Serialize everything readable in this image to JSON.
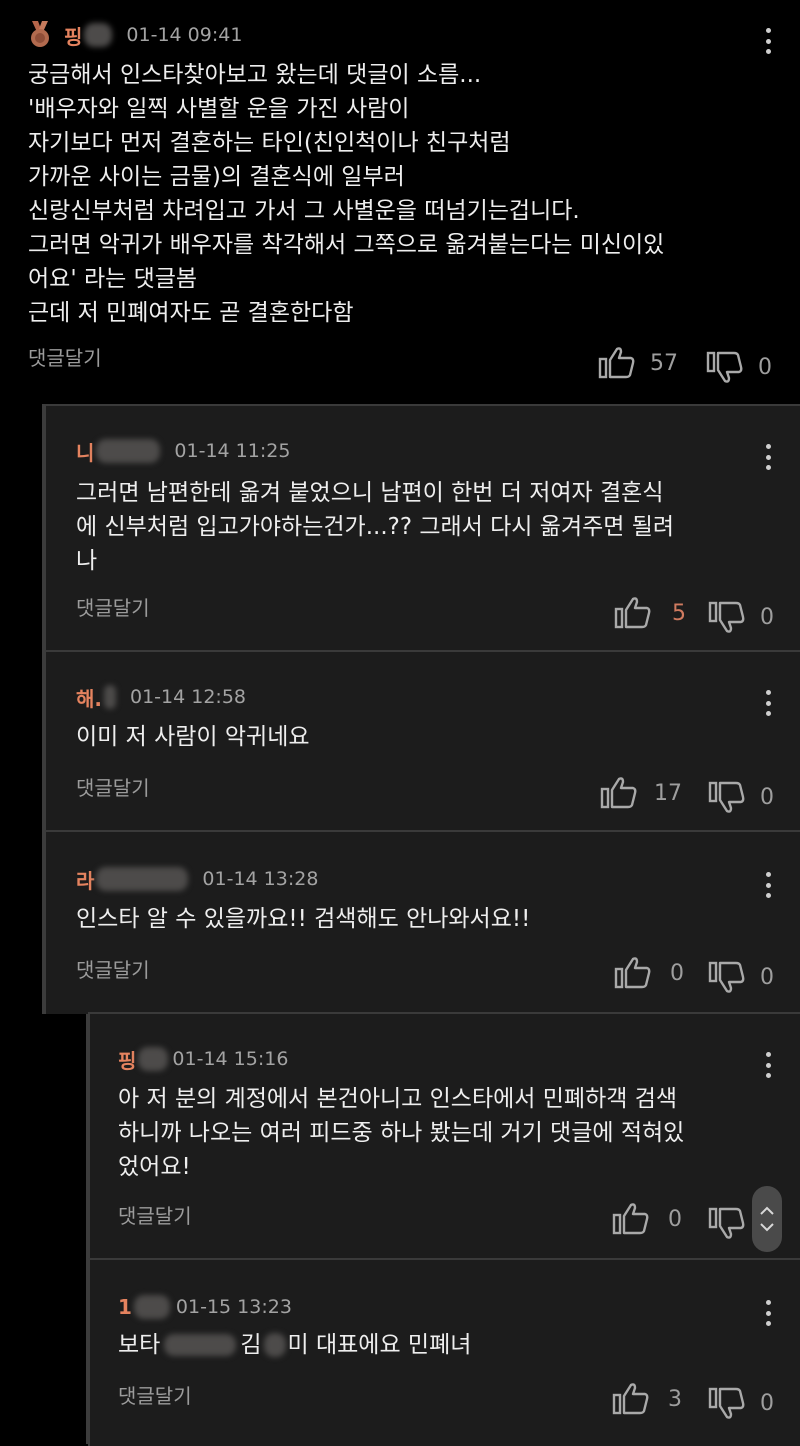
{
  "comments": [
    {
      "author_visible": "핑",
      "date": "01-14 09:41",
      "body": "궁금해서 인스타찾아보고 왔는데 댓글이 소름...\n'배우자와 일찍 사별할 운을 가진 사람이\n자기보다 먼저 결혼하는 타인(친인척이나 친구처럼\n가까운 사이는 금물)의 결혼식에 일부러\n신랑신부처럼 차려입고 가서 그 사별운을 떠넘기는겁니다.\n그러면 악귀가 배우자를 착각해서 그쪽으로 옮겨붙는다는 미신이있\n어요' 라는 댓글봄\n근데 저 민폐여자도 곧 결혼한다함",
      "reply_label": "댓글달기",
      "likes": "57",
      "dislikes": "0",
      "badge": "bronze-medal-icon"
    },
    {
      "author_visible": "니",
      "date": "01-14 11:25",
      "body": "그러면 남편한테 옮겨 붙었으니 남편이 한번 더 저여자 결혼식\n에 신부처럼 입고가야하는건가...?? 그래서 다시 옮겨주면 될려\n나",
      "reply_label": "댓글달기",
      "likes": "5",
      "dislikes": "0"
    },
    {
      "author_visible": "해.",
      "date": "01-14 12:58",
      "body": "이미 저 사람이 악귀네요",
      "reply_label": "댓글달기",
      "likes": "17",
      "dislikes": "0"
    },
    {
      "author_visible": "라",
      "date": "01-14 13:28",
      "body": "인스타 알 수 있을까요!! 검색해도 안나와서요!!",
      "reply_label": "댓글달기",
      "likes": "0",
      "dislikes": "0"
    },
    {
      "author_visible": "핑",
      "date": "01-14 15:16",
      "body": "아 저 분의 계정에서 본건아니고 인스타에서 민폐하객 검색\n하니까 나오는 여러 피드중 하나 봤는데 거기 댓글에 적혀있\n었어요!",
      "reply_label": "댓글달기",
      "likes": "0",
      "dislikes": ""
    },
    {
      "author_visible": "1",
      "date": "01-15 13:23",
      "body_parts": [
        "보타",
        "김",
        "미 대표에요 민폐녀"
      ],
      "reply_label": "댓글달기",
      "likes": "3",
      "dislikes": "0"
    }
  ],
  "colors": {
    "background": "#000000",
    "card": "#1c1c1c",
    "author": "#e5835f",
    "muted": "#9e9e9e"
  }
}
